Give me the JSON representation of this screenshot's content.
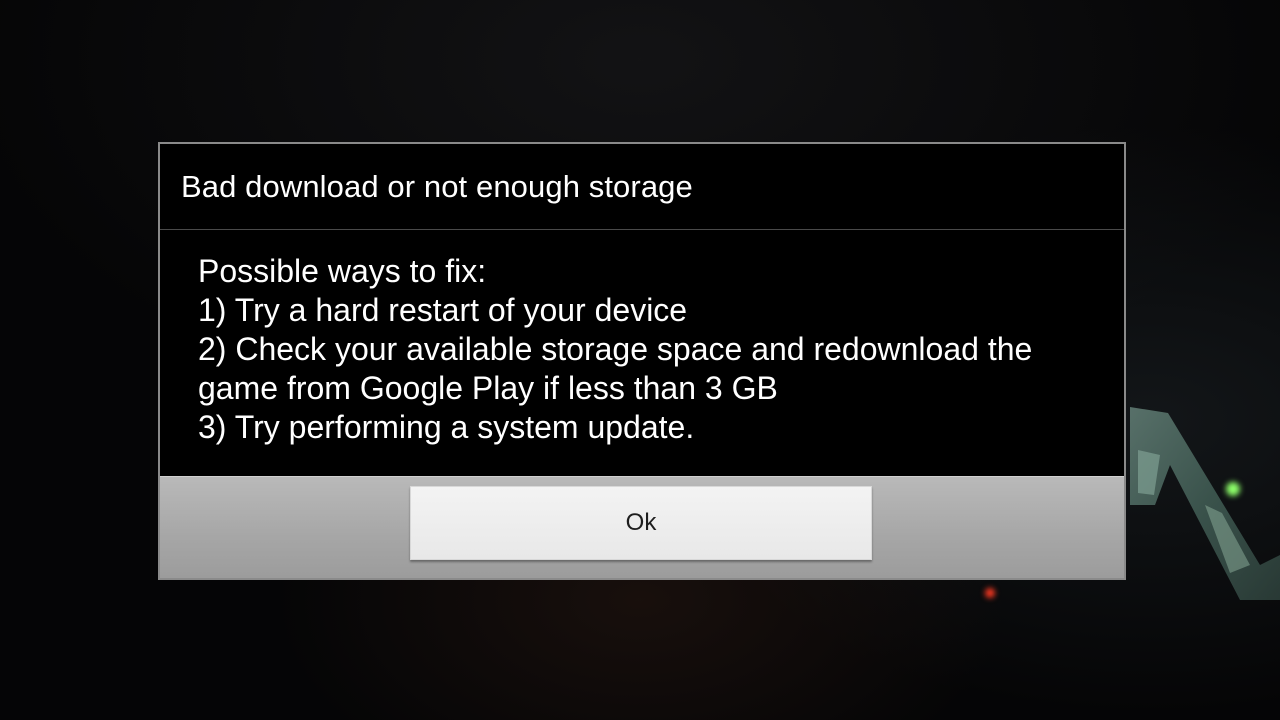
{
  "dialog": {
    "title": "Bad download or not enough storage",
    "message_lines": [
      "Possible ways to fix:",
      "1) Try a hard restart of your device",
      "2) Check your available storage space and redownload the",
      "game from Google Play if less than 3 GB",
      "3) Try performing a system update."
    ],
    "ok_label": "Ok"
  },
  "colors": {
    "dialog_background": "#000000",
    "dialog_border": "#8a8a8a",
    "footer_background": "#a8a8a8",
    "button_background": "#ececec",
    "text_primary": "#ffffff"
  },
  "background": {
    "logo_icon": "game-logo-fragment-icon"
  }
}
